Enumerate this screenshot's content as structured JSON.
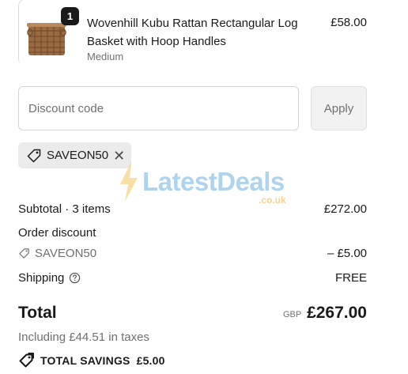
{
  "product": {
    "quantity_badge": "1",
    "title": "Wovenhill Kubu Rattan Rectangular Log Basket with Hoop Handles",
    "variant": "Medium",
    "price": "£58.00",
    "thumbnail_icon": "basket-image"
  },
  "discount": {
    "placeholder": "Discount code",
    "apply_label": "Apply",
    "applied_code": "SAVEON50",
    "remove_icon": "close-icon"
  },
  "watermark": {
    "text": "LatestDeals",
    "sub": ".co.uk"
  },
  "summary": {
    "subtotal_label": "Subtotal · 3 items",
    "subtotal_value": "£272.00",
    "order_discount_label": "Order discount",
    "discount_code": "SAVEON50",
    "discount_value": "– £5.00",
    "shipping_label": "Shipping",
    "shipping_value": "FREE",
    "total_label": "Total",
    "currency": "GBP",
    "total_value": "£267.00",
    "taxes_note": "Including £44.51 in taxes",
    "savings_label": "TOTAL SAVINGS",
    "savings_value": "£5.00"
  },
  "colors": {
    "badge_bg": "#1a1a1a",
    "chip_bg": "#ebebeb",
    "apply_bg": "#f2f2f2",
    "muted_text": "#707070"
  }
}
